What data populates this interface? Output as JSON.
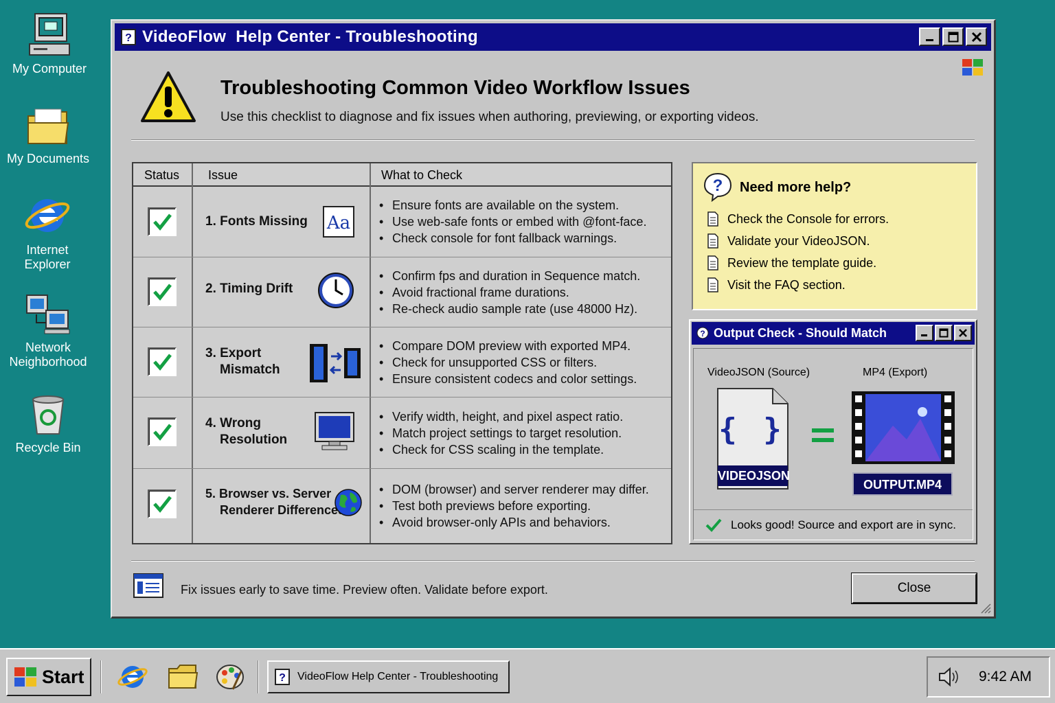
{
  "desktop": {
    "icons": [
      {
        "label": "My Computer"
      },
      {
        "label": "My Documents"
      },
      {
        "label": "Internet Explorer"
      },
      {
        "label": "Network Neighborhood"
      },
      {
        "label": "Recycle Bin"
      }
    ]
  },
  "window": {
    "title": "VideoFlow  Help Center - Troubleshooting",
    "heading": "Troubleshooting Common Video Workflow Issues",
    "subheading": "Use this checklist to diagnose and fix issues when authoring, previewing, or exporting videos."
  },
  "table": {
    "headers": {
      "status": "Status",
      "issue": "Issue",
      "check": "What to Check"
    },
    "rows": [
      {
        "issue_l1": "1. Fonts Missing",
        "issue_l2": "",
        "icon": "font-icon",
        "checked": true,
        "checks": [
          "Ensure fonts are available on the system.",
          "Use web-safe fonts or embed with @font-face.",
          "Check console for font fallback warnings."
        ]
      },
      {
        "issue_l1": "2. Timing Drift",
        "issue_l2": "",
        "icon": "clock-icon",
        "checked": true,
        "checks": [
          "Confirm fps and duration in Sequence match.",
          "Avoid fractional frame durations.",
          "Re-check audio sample rate (use 48000 Hz)."
        ]
      },
      {
        "issue_l1": "3. Export",
        "issue_l2": "Mismatch",
        "icon": "film-compare-icon",
        "checked": true,
        "checks": [
          "Compare DOM preview with exported MP4.",
          "Check for unsupported CSS or filters.",
          "Ensure consistent codecs and color settings."
        ]
      },
      {
        "issue_l1": "4. Wrong",
        "issue_l2": "Resolution",
        "icon": "monitor-icon",
        "checked": true,
        "checks": [
          "Verify width, height, and pixel aspect ratio.",
          "Match project settings to target resolution.",
          "Check for CSS scaling in the template."
        ]
      },
      {
        "issue_l1": "5. Browser vs. Server",
        "issue_l2": "Renderer Differences",
        "icon": "globe-icon",
        "checked": true,
        "checks": [
          "DOM (browser) and server renderer may differ.",
          "Test both previews before exporting.",
          "Avoid browser-only APIs and behaviors."
        ]
      }
    ]
  },
  "help": {
    "title": "Need more help?",
    "items": [
      "Check the Console for errors.",
      "Validate your VideoJSON.",
      "Review the template guide.",
      "Visit the FAQ section."
    ]
  },
  "output_check": {
    "title": "Output Check - Should Match",
    "source_label": "VideoJSON (Source)",
    "export_label": "MP4 (Export)",
    "source_braces": "{ }",
    "source_file": "VIDEOJSON",
    "export_file": "OUTPUT.MP4",
    "status": "Looks good! Source and export are in sync."
  },
  "footer": {
    "tip": "Fix issues early to save time. Preview often. Validate before export.",
    "close_label": "Close"
  },
  "taskbar": {
    "start_label": "Start",
    "task_label": "VideoFlow Help Center - Troubleshooting",
    "clock": "9:42 AM"
  },
  "colors": {
    "desktop": "#138484",
    "titlebar": "#0d0d88",
    "help_bg": "#f6efac",
    "check_green": "#13a043"
  }
}
